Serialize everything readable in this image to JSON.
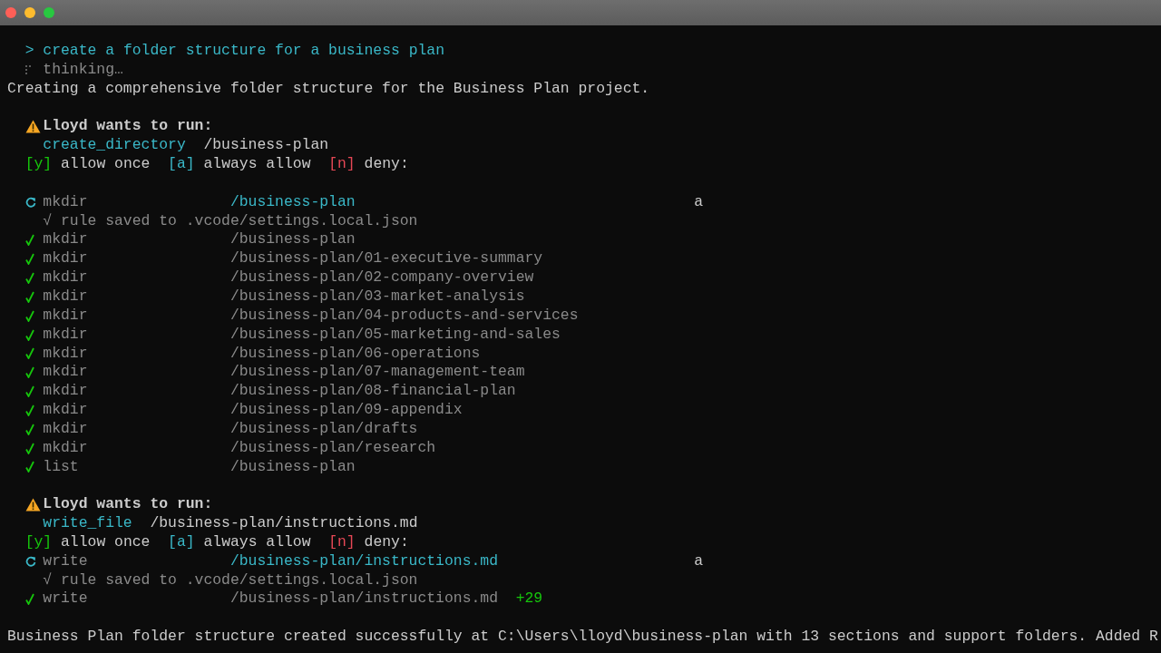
{
  "prompt": {
    "marker": ">",
    "text": "create a folder structure for a business plan"
  },
  "thinking": "thinking…",
  "message": "Creating a comprehensive folder structure for the Business Plan project.",
  "sections": [
    {
      "permission": {
        "title": "Lloyd wants to run:",
        "tool": "create_directory",
        "target": "/business-plan",
        "options": [
          {
            "key": "[y]",
            "label": "allow once",
            "color": "#16c60c"
          },
          {
            "key": "[a]",
            "label": "always allow",
            "color": "#3ab8c8"
          },
          {
            "key": "[n]",
            "label": "deny:",
            "color": "#e74856"
          }
        ]
      },
      "log": [
        {
          "kind": "pending",
          "command": "mkdir",
          "path": "/business-plan",
          "answer": "a"
        },
        {
          "kind": "note",
          "text": "√ rule saved to .vcode/settings.local.json"
        },
        {
          "kind": "done",
          "command": "mkdir",
          "path": "/business-plan"
        },
        {
          "kind": "done",
          "command": "mkdir",
          "path": "/business-plan/01-executive-summary"
        },
        {
          "kind": "done",
          "command": "mkdir",
          "path": "/business-plan/02-company-overview"
        },
        {
          "kind": "done",
          "command": "mkdir",
          "path": "/business-plan/03-market-analysis"
        },
        {
          "kind": "done",
          "command": "mkdir",
          "path": "/business-plan/04-products-and-services"
        },
        {
          "kind": "done",
          "command": "mkdir",
          "path": "/business-plan/05-marketing-and-sales"
        },
        {
          "kind": "done",
          "command": "mkdir",
          "path": "/business-plan/06-operations"
        },
        {
          "kind": "done",
          "command": "mkdir",
          "path": "/business-plan/07-management-team"
        },
        {
          "kind": "done",
          "command": "mkdir",
          "path": "/business-plan/08-financial-plan"
        },
        {
          "kind": "done",
          "command": "mkdir",
          "path": "/business-plan/09-appendix"
        },
        {
          "kind": "done",
          "command": "mkdir",
          "path": "/business-plan/drafts"
        },
        {
          "kind": "done",
          "command": "mkdir",
          "path": "/business-plan/research"
        },
        {
          "kind": "done",
          "command": "list",
          "path": "/business-plan"
        }
      ]
    },
    {
      "permission": {
        "title": "Lloyd wants to run:",
        "tool": "write_file",
        "target": "/business-plan/instructions.md",
        "options": [
          {
            "key": "[y]",
            "label": "allow once",
            "color": "#16c60c"
          },
          {
            "key": "[a]",
            "label": "always allow",
            "color": "#3ab8c8"
          },
          {
            "key": "[n]",
            "label": "deny:",
            "color": "#e74856"
          }
        ]
      },
      "log": [
        {
          "kind": "pending",
          "command": "write",
          "path": "/business-plan/instructions.md",
          "answer": "a"
        },
        {
          "kind": "note",
          "text": "√ rule saved to .vcode/settings.local.json"
        },
        {
          "kind": "done",
          "command": "write",
          "path": "/business-plan/instructions.md",
          "added": "+29"
        }
      ]
    }
  ],
  "summary": "Business Plan folder structure created successfully at C:\\Users\\lloyd\\business-plan with 13 sections and support folders. Added R"
}
